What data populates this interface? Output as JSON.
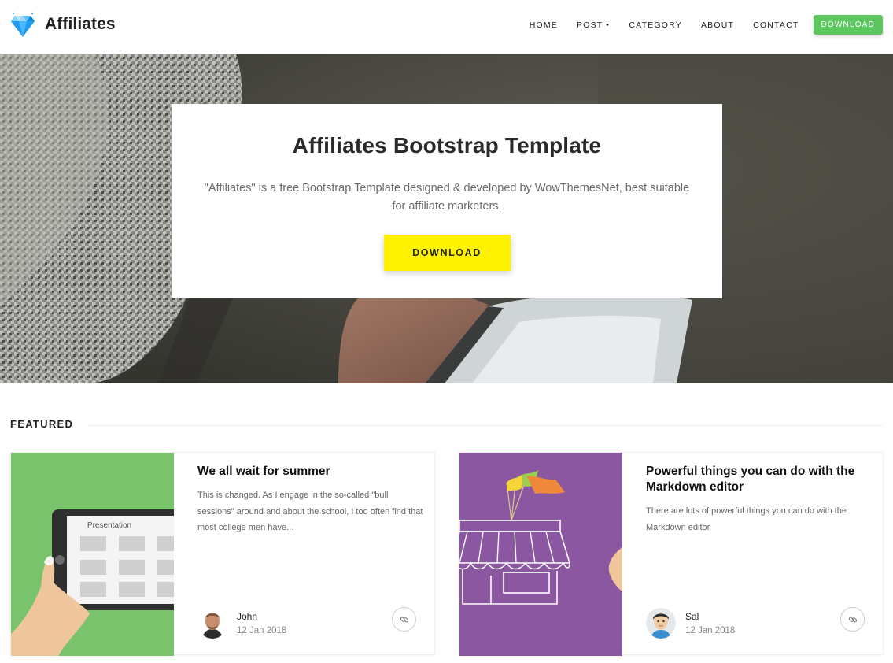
{
  "header": {
    "brand": "Affiliates",
    "nav": [
      "HOME",
      "POST",
      "CATEGORY",
      "ABOUT",
      "CONTACT"
    ],
    "download_label": "DOWNLOAD"
  },
  "hero": {
    "title": "Affiliates Bootstrap Template",
    "subtitle": "\"Affiliates\" is a free Bootstrap Template designed & developed by WowThemesNet, best suitable for affiliate marketers.",
    "button_label": "DOWNLOAD"
  },
  "featured": {
    "heading": "FEATURED",
    "posts": [
      {
        "title": "We all wait for summer",
        "excerpt": "This is changed. As I engage in the so-called \"bull sessions\" around and about the school, I too often find that most college men have...",
        "author": "John",
        "date": "12 Jan 2018",
        "image_label": "Presentation",
        "image_color": "#79c36d"
      },
      {
        "title": "Powerful things you can do with the Markdown editor",
        "excerpt": "There are lots of powerful things you can do with the Markdown editor",
        "author": "Sal",
        "date": "12 Jan 2018",
        "image_color": "#8b57a1"
      }
    ]
  },
  "colors": {
    "accent_green": "#5cc65f",
    "hero_button": "#fff200",
    "brand_diamond": "#1e9cf0"
  }
}
